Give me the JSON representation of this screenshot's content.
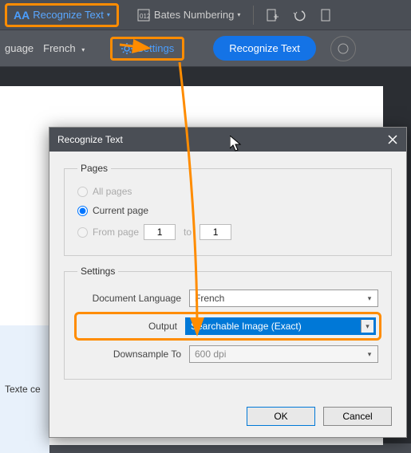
{
  "toolbar": {
    "recognize_text_menu": "Recognize Text",
    "bates_numbering": "Bates Numbering"
  },
  "subbar": {
    "language_label": "guage",
    "language_value": "French",
    "settings_label": "Settings",
    "recognize_button": "Recognize Text"
  },
  "doc": {
    "side_text": "Texte ce"
  },
  "dialog": {
    "title": "Recognize Text",
    "pages_legend": "Pages",
    "all_pages": "All pages",
    "current_page": "Current page",
    "from_page": "From page",
    "from_value": "1",
    "to_label": "to",
    "to_value": "1",
    "settings_legend": "Settings",
    "doc_lang_label": "Document Language",
    "doc_lang_value": "French",
    "output_label": "Output",
    "output_value": "Searchable Image (Exact)",
    "downsample_label": "Downsample To",
    "downsample_value": "600 dpi",
    "ok": "OK",
    "cancel": "Cancel"
  },
  "icons": {
    "aa": "AA",
    "caret": "▾"
  }
}
